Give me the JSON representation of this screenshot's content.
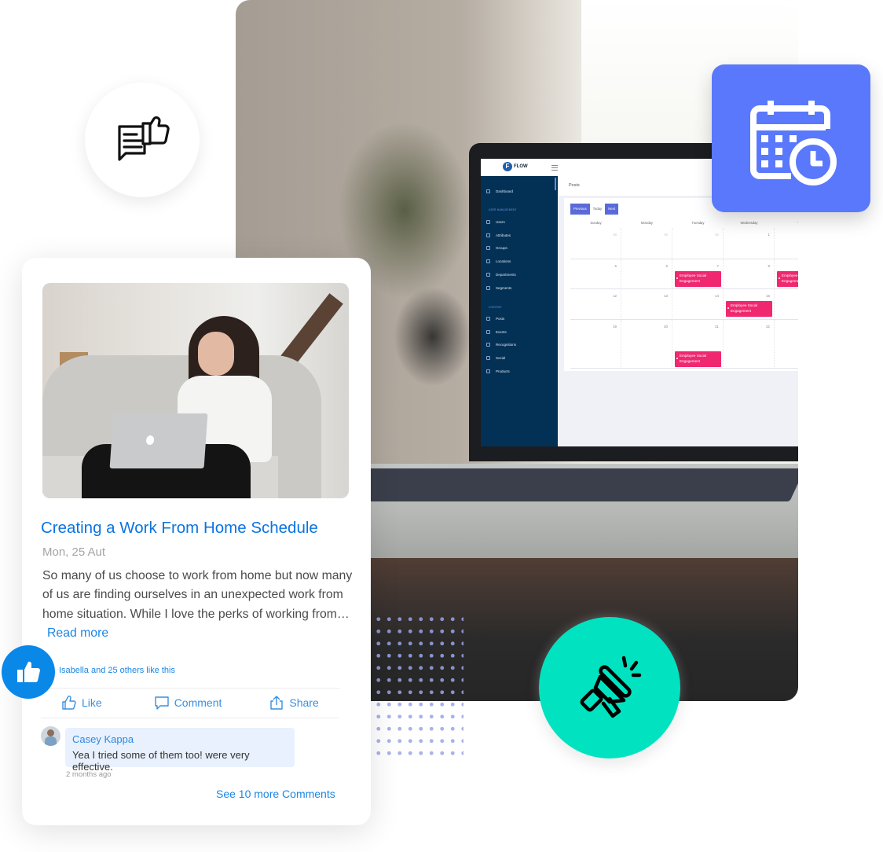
{
  "app": {
    "logo_text": "FLOW",
    "logo_letter": "F",
    "page_title": "Posts",
    "sidebar": {
      "items_top": [
        {
          "label": "Dashboard",
          "icon": "dashboard-icon"
        }
      ],
      "sections": [
        {
          "heading": "USER MANAGEMENT",
          "items": [
            {
              "label": "Users",
              "icon": "user-icon"
            },
            {
              "label": "Attributes",
              "icon": "attributes-icon"
            },
            {
              "label": "Groups",
              "icon": "groups-icon"
            },
            {
              "label": "Locations",
              "icon": "location-pin-icon"
            },
            {
              "label": "Departments",
              "icon": "departments-icon"
            },
            {
              "label": "Segments",
              "icon": "segments-icon"
            }
          ]
        },
        {
          "heading": "CONTENT",
          "items": [
            {
              "label": "Posts",
              "icon": "posts-icon"
            },
            {
              "label": "Events",
              "icon": "events-icon"
            },
            {
              "label": "Recognitions",
              "icon": "trophy-icon"
            },
            {
              "label": "Social",
              "icon": "social-icon"
            },
            {
              "label": "Products",
              "icon": "products-icon"
            }
          ]
        }
      ]
    },
    "calendar": {
      "buttons": {
        "previous": "Previous",
        "today": "Today",
        "next": "Next"
      },
      "day_headers": [
        "Sunday",
        "Monday",
        "Tuesday",
        "Wednesday",
        "Thu"
      ],
      "weeks": [
        {
          "days": [
            "28",
            "29",
            "30",
            "1",
            ""
          ],
          "dim": [
            true,
            true,
            true,
            false,
            false
          ]
        },
        {
          "days": [
            "5",
            "6",
            "7",
            "8",
            ""
          ],
          "dim": [
            false,
            false,
            false,
            false,
            false
          ]
        },
        {
          "days": [
            "12",
            "13",
            "14",
            "15",
            ""
          ],
          "dim": [
            false,
            false,
            false,
            false,
            false
          ]
        },
        {
          "days": [
            "19",
            "20",
            "21",
            "22",
            ""
          ],
          "dim": [
            false,
            false,
            false,
            false,
            false
          ]
        }
      ],
      "events": [
        {
          "title": "Employee Social Engagement",
          "week": 1,
          "day": 2
        },
        {
          "title": "Employee Social Engagement",
          "week": 1,
          "day": 4
        },
        {
          "title": "Employee Social Engagement",
          "week": 2,
          "day": 3
        },
        {
          "title": "Employee Social Engagement",
          "week": 3,
          "day": 2
        }
      ],
      "event_color": "#f0286f"
    }
  },
  "post_card": {
    "title": "Creating a Work From Home Schedule",
    "date": "Mon, 25 Aut",
    "excerpt": "So many of us choose to work from home but now many of us are finding ourselves in an unexpected work from home situation. While I love the perks of working from…",
    "read_more": "Read more",
    "likes_text": "Isabella and 25 others like this",
    "actions": {
      "like": "Like",
      "comment": "Comment",
      "share": "Share"
    },
    "comment": {
      "author": "Casey Kappa",
      "text": "Yea I tried some of them too! were very effective.",
      "time": "2 months ago"
    },
    "see_more": "See 10 more Comments"
  },
  "colors": {
    "link_blue": "#0a74e1",
    "calendar_badge": "#5a78fb",
    "megaphone_badge": "#01e3c0",
    "thumb_badge": "#0a88e8",
    "sidebar_navy": "#033156"
  }
}
